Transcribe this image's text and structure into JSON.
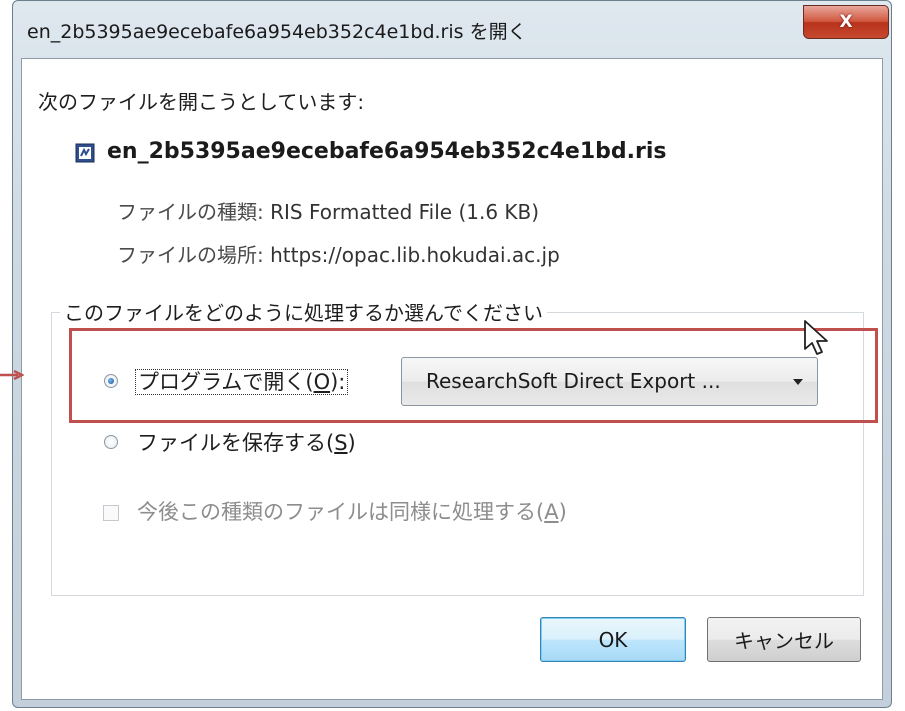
{
  "window": {
    "title": "en_2b5395ae9ecebafe6a954eb352c4e1bd.ris を開く",
    "close_glyph": "X"
  },
  "dialog": {
    "intro": "次のファイルを開こうとしています:",
    "file_name": "en_2b5395ae9ecebafe6a954eb352c4e1bd.ris",
    "file_type_label": "ファイルの種類:",
    "file_type_value": "RIS Formatted File (1.6 KB)",
    "file_location_label": "ファイルの場所:",
    "file_location_value": "https://opac.lib.hokudai.ac.jp"
  },
  "action_group": {
    "legend": "このファイルをどのように処理するか選んでください",
    "open_with": {
      "label_prefix": "プログラムで開く(",
      "accel": "O",
      "label_suffix": "):",
      "selected": true
    },
    "program_select": {
      "value": "ResearchSoft Direct Export ..."
    },
    "save_file": {
      "label_prefix": "ファイルを保存する(",
      "accel": "S",
      "label_suffix": ")",
      "selected": false
    },
    "remember": {
      "label_prefix": "今後この種類のファイルは同様に処理する(",
      "accel": "A",
      "label_suffix": ")",
      "checked": false,
      "disabled": true
    }
  },
  "buttons": {
    "ok": "OK",
    "cancel": "キャンセル"
  },
  "colors": {
    "highlight_box": "#c0504d",
    "close_button": "#c6492f",
    "ok_border": "#3c7fb1"
  },
  "icons": {
    "file_icon": "ris-file-icon",
    "cursor": "mouse-pointer-icon",
    "annotation_arrow": "arrow-right-icon"
  }
}
